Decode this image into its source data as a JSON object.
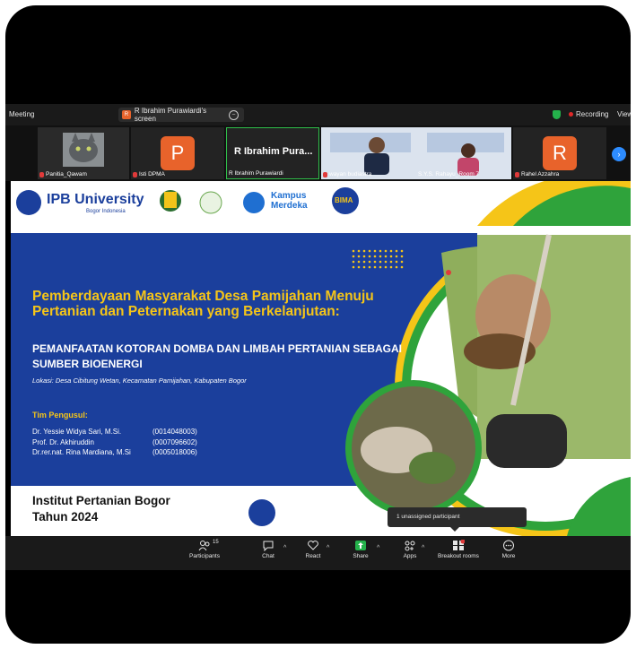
{
  "topbar": {
    "meeting_label": "Meeting",
    "share_label": "R Ibrahim Purawiardi's screen",
    "recording_label": "Recording",
    "view_label": "View"
  },
  "participants_strip": [
    {
      "name": "Panitia_Qawam",
      "avatar": ""
    },
    {
      "name": "Isti DPMA",
      "avatar": "P"
    },
    {
      "name": "R Ibrahim Purawiardi",
      "display": "R Ibrahim Pura..."
    },
    {
      "name": "wayan budiastra",
      "avatar": ""
    },
    {
      "name": "S.Y.S. Rahayu_Room 7",
      "avatar": ""
    },
    {
      "name": "Rahel Azzahra",
      "avatar": "R"
    }
  ],
  "slide": {
    "university": "IPB University",
    "university_sub": "Bogor Indonesia",
    "kampus": "Kampus",
    "merdeka": "Merdeka",
    "bima": "BIMA",
    "title": "Pemberdayaan Masyarakat Desa Pamijahan Menuju Pertanian dan Peternakan yang Berkelanjutan:",
    "subtitle": "PEMANFAATAN KOTORAN DOMBA DAN LIMBAH PERTANIAN SEBAGAI SUMBER BIOENERGI",
    "lokasi": "Lokasi: Desa Cibitung Wetan, Kecamatan Pamijahan, Kabupaten Bogor",
    "tim_label": "Tim Pengusul:",
    "members": [
      {
        "name": "Dr. Yessie Widya Sari, M.Si.",
        "id": "(0014048003)"
      },
      {
        "name": "Prof. Dr. Akhiruddin",
        "id": "(0007096602)"
      },
      {
        "name": "Dr.rer.nat. Rina Mardiana, M.Si",
        "id": "(0005018006)"
      }
    ],
    "institution": "Institut Pertanian Bogor",
    "year": "Tahun 2024"
  },
  "tooltip": "1 unassigned participant",
  "toolbar": {
    "participants_count": "15",
    "participants": "Participants",
    "chat": "Chat",
    "react": "React",
    "share": "Share",
    "apps": "Apps",
    "breakout": "Breakout rooms",
    "more": "More"
  },
  "colors": {
    "slide_blue": "#1b3f9c",
    "accent_yellow": "#f5c518",
    "accent_green": "#2fa33b",
    "share_green": "#24b24b",
    "zoom_blue": "#2d8cff"
  }
}
